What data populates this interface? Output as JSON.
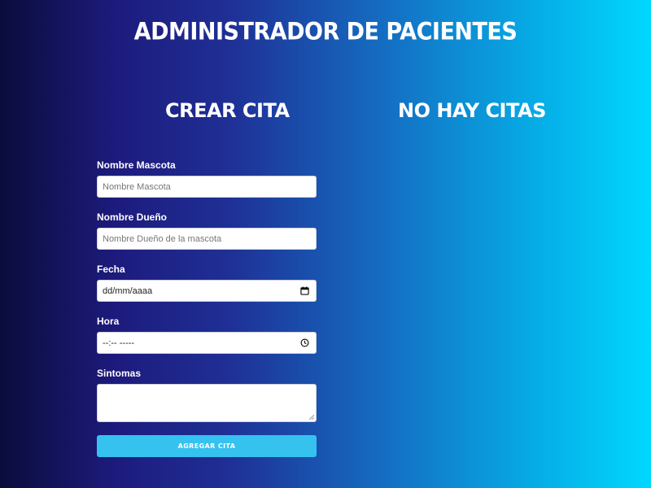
{
  "header": {
    "title": "ADMINISTRADOR DE PACIENTES"
  },
  "form_section": {
    "title": "CREAR CITA",
    "fields": {
      "pet_name": {
        "label": "Nombre Mascota",
        "placeholder": "Nombre Mascota"
      },
      "owner_name": {
        "label": "Nombre Dueño",
        "placeholder": "Nombre  Dueño de la mascota"
      },
      "date": {
        "label": "Fecha",
        "value": "dd/mm/aaaa",
        "icon": "calendar-icon"
      },
      "time": {
        "label": "Hora",
        "value": "--:-- -----",
        "icon": "clock-icon"
      },
      "symptoms": {
        "label": "Sintomas",
        "value": ""
      }
    },
    "submit_label": "AGREGAR CITA"
  },
  "appointments_section": {
    "title": "NO HAY CITAS"
  },
  "colors": {
    "gradient_start": "#0a0c3c",
    "gradient_mid": "#1f2f95",
    "gradient_end": "#00d8ff",
    "button": "#35c2ef",
    "text": "#ffffff"
  }
}
